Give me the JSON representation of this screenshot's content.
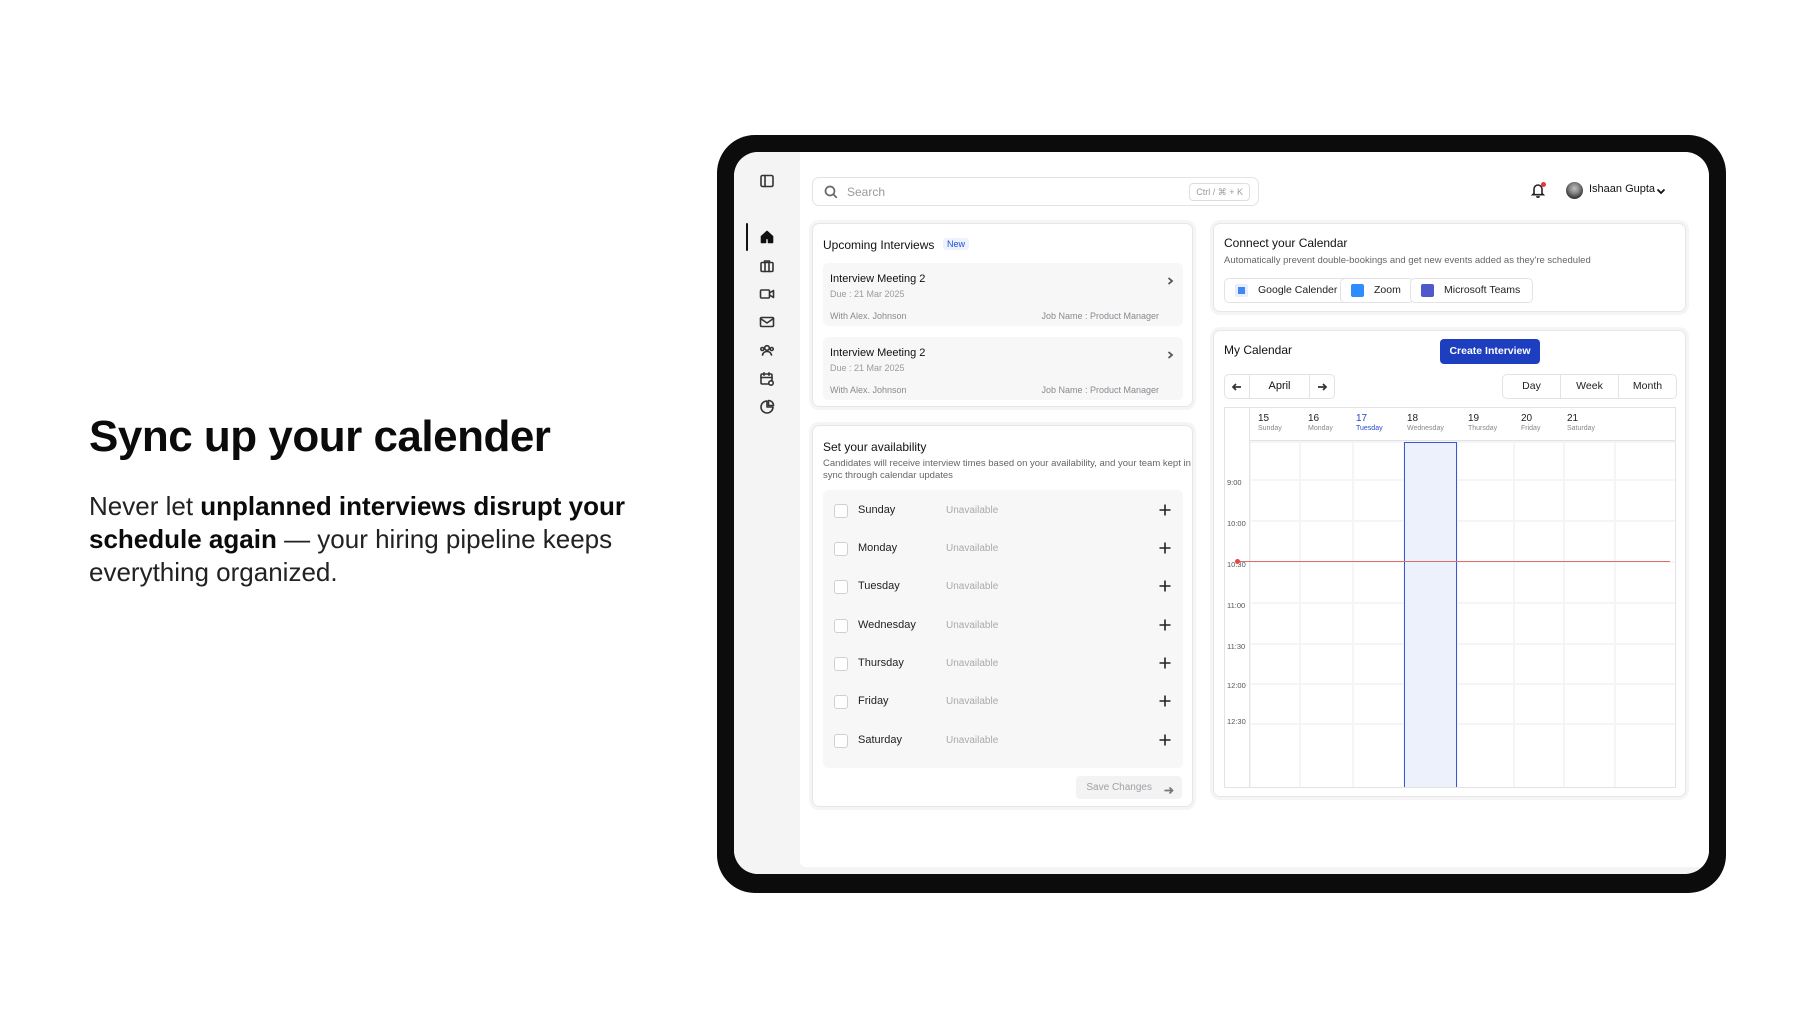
{
  "hero": {
    "title": "Sync up your calender",
    "body_pre": "Never let ",
    "body_bold": "unplanned interviews disrupt your schedule again",
    "body_post": " — your hiring pipeline keeps everything organized."
  },
  "rail": {
    "icons": [
      "sidebar-toggle-icon",
      "home-icon",
      "briefcase-icon",
      "video-icon",
      "mail-icon",
      "users-icon",
      "calendar-settings-icon",
      "pie-chart-icon"
    ]
  },
  "topbar": {
    "search_placeholder": "Search",
    "search_shortcut": "Ctrl / ⌘ + K",
    "user_name": "Ishaan Gupta"
  },
  "upcoming": {
    "title": "Upcoming Interviews",
    "badge": "New",
    "items": [
      {
        "title": "Interview Meeting 2",
        "due": "Due : 21 Mar 2025",
        "with": "With Alex. Johnson",
        "job": "Job Name : Product Manager"
      },
      {
        "title": "Interview Meeting 2",
        "due": "Due : 21 Mar 2025",
        "with": "With Alex. Johnson",
        "job": "Job Name : Product Manager"
      }
    ]
  },
  "availability": {
    "title": "Set your availability",
    "description": "Candidates will receive interview times based on your availability, and your team kept in sync through calendar updates",
    "days": [
      {
        "name": "Sunday",
        "status": "Unavailable"
      },
      {
        "name": "Monday",
        "status": "Unavailable"
      },
      {
        "name": "Tuesday",
        "status": "Unavailable"
      },
      {
        "name": "Wednesday",
        "status": "Unavailable"
      },
      {
        "name": "Thursday",
        "status": "Unavailable"
      },
      {
        "name": "Friday",
        "status": "Unavailable"
      },
      {
        "name": "Saturday",
        "status": "Unavailable"
      }
    ],
    "save_label": "Save Changes"
  },
  "connect": {
    "title": "Connect your Calendar",
    "description": "Automatically prevent double-bookings and get new events added as they're scheduled",
    "providers": [
      {
        "label": "Google Calender",
        "color": "#4285f4"
      },
      {
        "label": "Zoom",
        "color": "#2d8cff"
      },
      {
        "label": "Microsoft Teams",
        "color": "#5059c9"
      }
    ]
  },
  "calendar": {
    "title": "My Calendar",
    "create_label": "Create Interview",
    "month": "April",
    "views": [
      "Day",
      "Week",
      "Month"
    ],
    "days": [
      {
        "num": "15",
        "name": "Sunday"
      },
      {
        "num": "16",
        "name": "Monday"
      },
      {
        "num": "17",
        "name": "Tuesday",
        "selected": true
      },
      {
        "num": "18",
        "name": "Wednesday"
      },
      {
        "num": "19",
        "name": "Thursday"
      },
      {
        "num": "20",
        "name": "Friday"
      },
      {
        "num": "21",
        "name": "Saturday"
      }
    ],
    "times": [
      "9:00",
      "10:00",
      "10:30",
      "11:00",
      "11:30",
      "12:00",
      "12:30"
    ],
    "accent": "#1d3fbf",
    "now_color": "#e04848"
  }
}
